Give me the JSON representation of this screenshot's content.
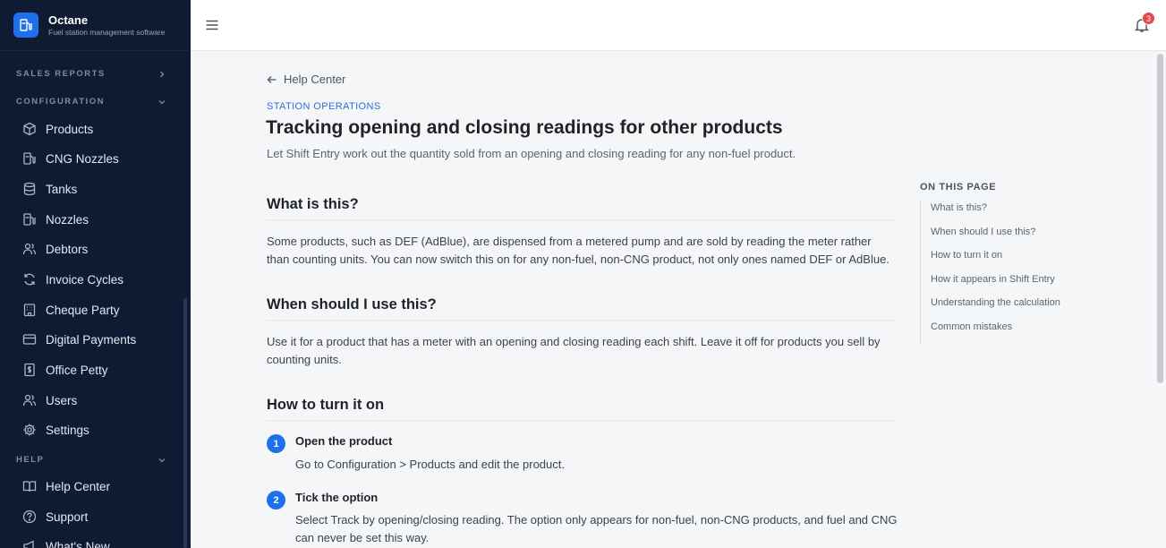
{
  "brand": {
    "name": "Octane",
    "tagline": "Fuel station management software"
  },
  "colors": {
    "sidebar_bg": "#0f1b33",
    "accent": "#1f6feb",
    "badge": "#e5484d"
  },
  "sidebar": {
    "sections": [
      {
        "label": "SALES REPORTS",
        "expanded": false
      },
      {
        "label": "CONFIGURATION",
        "expanded": true
      },
      {
        "label": "HELP",
        "expanded": true
      }
    ],
    "config_items": [
      {
        "label": "Products",
        "icon": "box-icon"
      },
      {
        "label": "CNG Nozzles",
        "icon": "fuel-pump-icon"
      },
      {
        "label": "Tanks",
        "icon": "database-icon"
      },
      {
        "label": "Nozzles",
        "icon": "fuel-pump-icon"
      },
      {
        "label": "Debtors",
        "icon": "users-icon"
      },
      {
        "label": "Invoice Cycles",
        "icon": "refresh-icon"
      },
      {
        "label": "Cheque Party",
        "icon": "building-icon"
      },
      {
        "label": "Digital Payments",
        "icon": "credit-card-icon"
      },
      {
        "label": "Office Petty",
        "icon": "receipt-icon"
      },
      {
        "label": "Users",
        "icon": "users-icon"
      },
      {
        "label": "Settings",
        "icon": "gear-icon"
      }
    ],
    "help_items": [
      {
        "label": "Help Center",
        "icon": "book-icon"
      },
      {
        "label": "Support",
        "icon": "help-circle-icon"
      },
      {
        "label": "What's New",
        "icon": "megaphone-icon"
      }
    ]
  },
  "topbar": {
    "notification_count": "3"
  },
  "article": {
    "back_label": "Help Center",
    "category": "STATION OPERATIONS",
    "title": "Tracking opening and closing readings for other products",
    "subtitle": "Let Shift Entry work out the quantity sold from an opening and closing reading for any non-fuel product.",
    "sections": {
      "what": {
        "heading": "What is this?",
        "body": "Some products, such as DEF (AdBlue), are dispensed from a metered pump and are sold by reading the meter rather than counting units. You can now switch this on for any non-fuel, non-CNG product, not only ones named DEF or AdBlue."
      },
      "when": {
        "heading": "When should I use this?",
        "body": "Use it for a product that has a meter with an opening and closing reading each shift. Leave it off for products you sell by counting units."
      },
      "how": {
        "heading": "How to turn it on",
        "steps": [
          {
            "num": "1",
            "title": "Open the product",
            "body": "Go to Configuration > Products and edit the product."
          },
          {
            "num": "2",
            "title": "Tick the option",
            "body": "Select Track by opening/closing reading. The option only appears for non-fuel, non-CNG products, and fuel and CNG can never be set this way."
          }
        ]
      }
    }
  },
  "toc": {
    "title": "ON THIS PAGE",
    "items": [
      "What is this?",
      "When should I use this?",
      "How to turn it on",
      "How it appears in Shift Entry",
      "Understanding the calculation",
      "Common mistakes"
    ]
  }
}
